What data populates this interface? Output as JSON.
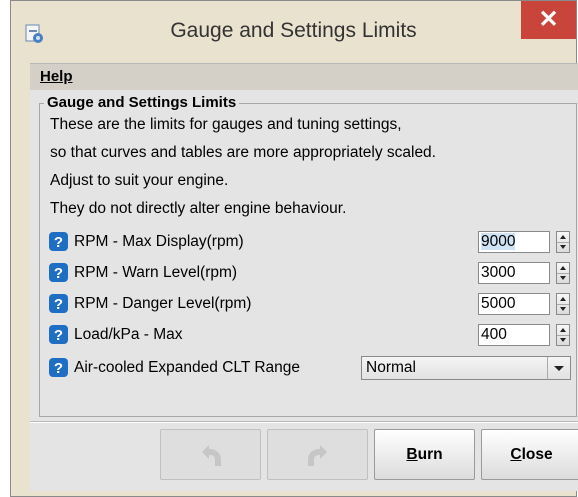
{
  "window": {
    "title": "Gauge and Settings Limits",
    "close_glyph": "✕"
  },
  "menu": {
    "help": "Help"
  },
  "group": {
    "legend": "Gauge and Settings Limits",
    "description": [
      "These are the limits for gauges and tuning settings,",
      "so that curves and tables are more appropriately scaled.",
      "Adjust to suit your engine.",
      "They do not directly alter engine behaviour."
    ]
  },
  "settings": [
    {
      "label": "RPM - Max Display(rpm)",
      "value": "9000",
      "selected": true
    },
    {
      "label": "RPM - Warn Level(rpm)",
      "value": "3000"
    },
    {
      "label": "RPM - Danger Level(rpm)",
      "value": "5000"
    },
    {
      "label": "Load/kPa - Max",
      "value": "400"
    }
  ],
  "clt_range": {
    "label": "Air-cooled Expanded CLT Range",
    "value": "Normal"
  },
  "buttons": {
    "undo_icon": "undo-icon",
    "redo_icon": "redo-icon",
    "burn_first": "B",
    "burn_rest": "urn",
    "close_first": "C",
    "close_rest": "lose"
  },
  "colors": {
    "close_button": "#c9443a",
    "help_icon": "#1e6fc4",
    "selection": "#cfe3f7"
  }
}
